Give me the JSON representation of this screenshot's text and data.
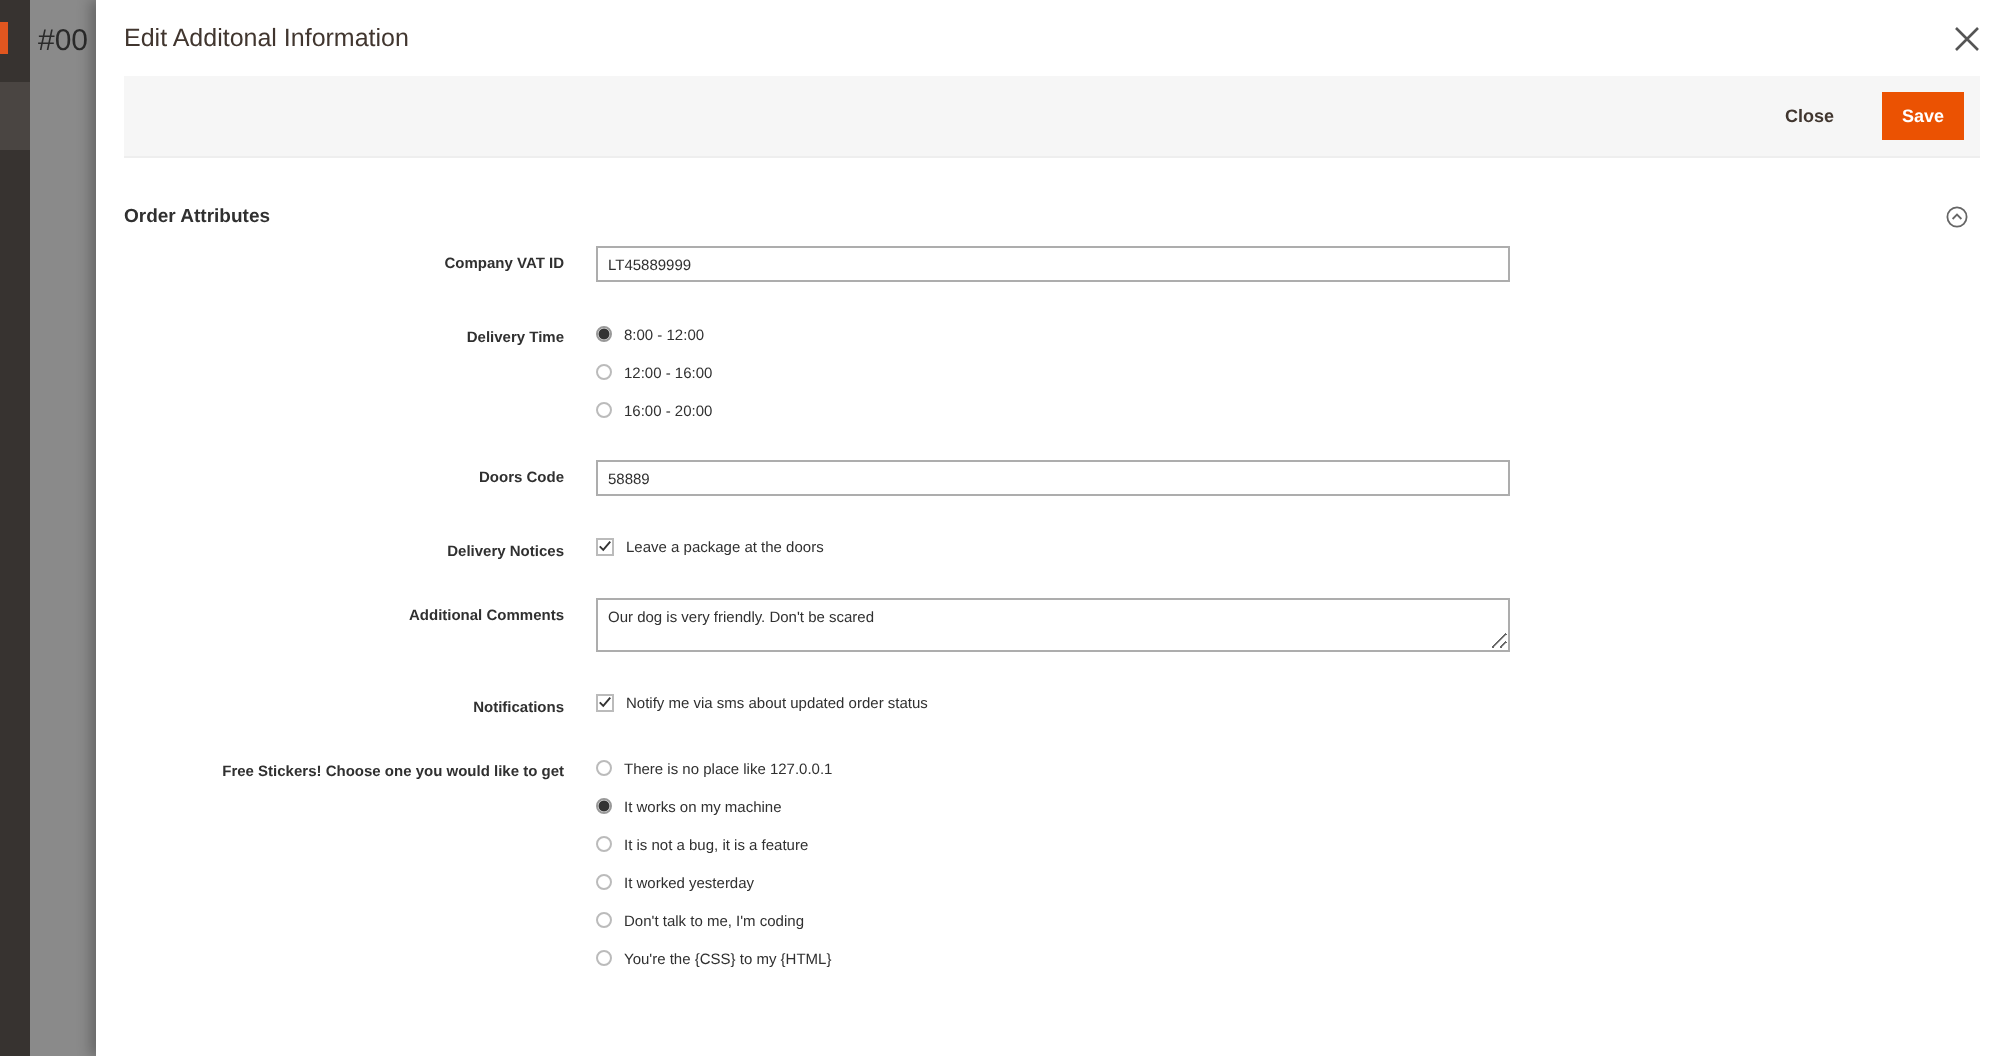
{
  "background": {
    "page_title": "#00"
  },
  "modal": {
    "title": "Edit Additonal Information",
    "buttons": [
      {
        "label": "Close",
        "kind": "secondary"
      },
      {
        "label": "Save",
        "kind": "primary"
      }
    ],
    "section": {
      "title": "Order Attributes",
      "expanded": true,
      "fields": [
        {
          "label": "Company VAT ID",
          "kind": "text",
          "value": "LT45889999"
        },
        {
          "label": "Delivery Time",
          "kind": "radio",
          "options": [
            {
              "label": "8:00 - 12:00",
              "selected": true
            },
            {
              "label": "12:00 - 16:00",
              "selected": false
            },
            {
              "label": "16:00 - 20:00",
              "selected": false
            }
          ]
        },
        {
          "label": "Doors Code",
          "kind": "text",
          "value": "58889"
        },
        {
          "label": "Delivery Notices",
          "kind": "checkbox",
          "option": "Leave a package at the doors",
          "checked": true
        },
        {
          "label": "Additional Comments",
          "kind": "textarea",
          "value": "Our dog is very friendly. Don't be scared"
        },
        {
          "label": "Notifications",
          "kind": "checkbox",
          "option": "Notify me via sms about updated order status",
          "checked": true
        },
        {
          "label": "Free Stickers! Choose one you would like to get",
          "kind": "radio",
          "options": [
            {
              "label": "There is no place like 127.0.0.1",
              "selected": false
            },
            {
              "label": "It works on my machine",
              "selected": true
            },
            {
              "label": "It is not a bug, it is a feature",
              "selected": false
            },
            {
              "label": "It worked yesterday",
              "selected": false
            },
            {
              "label": "Don't talk to me, I'm coding",
              "selected": false
            },
            {
              "label": "You're the {CSS} to my {HTML}",
              "selected": false
            }
          ]
        }
      ]
    }
  }
}
